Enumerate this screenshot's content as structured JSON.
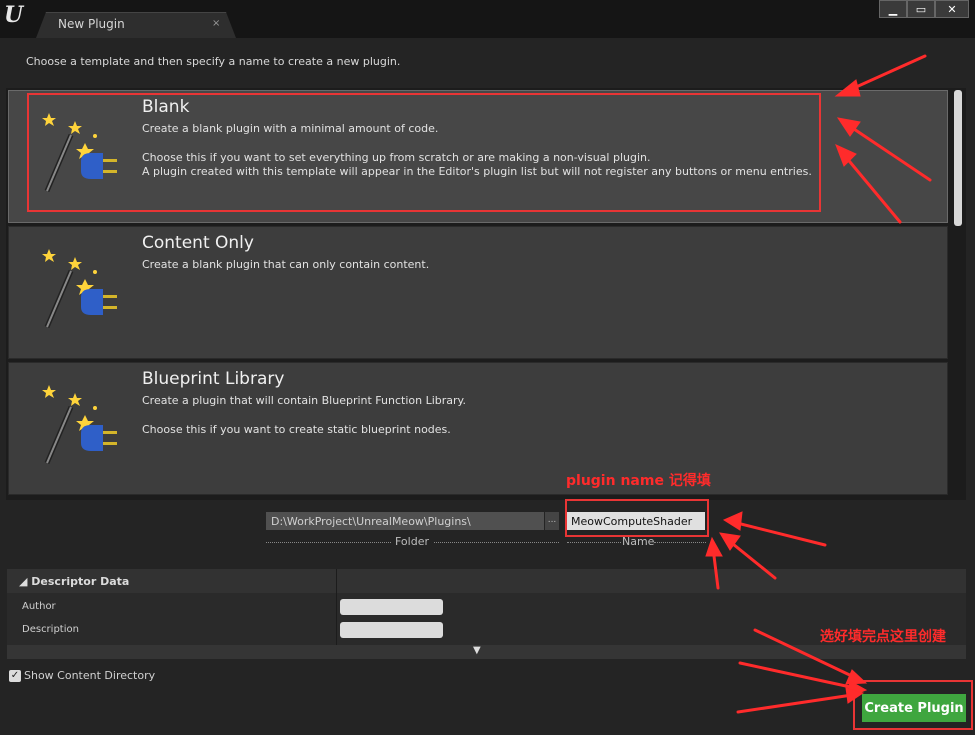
{
  "window": {
    "tab_title": "New Plugin",
    "tab_close": "×",
    "minimize": "▁",
    "maximize": "▭",
    "close": "✕"
  },
  "subtitle": "Choose a template and then specify a name to create a new plugin.",
  "templates": [
    {
      "name": "Blank",
      "desc1": "Create a blank plugin with a minimal amount of code.",
      "desc2": "Choose this if you want to set everything up from scratch or are making a non-visual plugin.",
      "desc3": "A plugin created with this template will appear in the Editor's plugin list but will not register any buttons or menu entries.",
      "selected": true
    },
    {
      "name": "Content Only",
      "desc1": "Create a blank plugin that can only contain content.",
      "selected": false
    },
    {
      "name": "Blueprint Library",
      "desc1": "Create a plugin that will contain Blueprint Function Library.",
      "desc2": "Choose this if you want to create static blueprint nodes.",
      "selected": false
    }
  ],
  "folder": {
    "value": "D:\\WorkProject\\UnrealMeow\\Plugins\\",
    "browse": "...",
    "label": "Folder"
  },
  "name_field": {
    "value": "MeowComputeShader",
    "label": "Name"
  },
  "descriptor": {
    "title": "◢ Descriptor Data",
    "rows": [
      {
        "label": "Author",
        "value": ""
      },
      {
        "label": "Description",
        "value": ""
      }
    ],
    "expand": "▼"
  },
  "show_content": {
    "checked": "✓",
    "label": "Show Content Directory"
  },
  "create_button": "Create Plugin",
  "annotations": {
    "plugin_name_note": "plugin name 记得填",
    "create_note": "选好填完点这里创建"
  },
  "colors": {
    "accent_green": "#3fa63f",
    "annotation_red": "#e93535"
  }
}
